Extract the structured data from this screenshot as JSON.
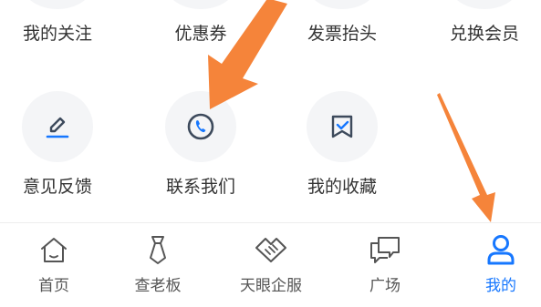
{
  "menu": {
    "row1": [
      "我的关注",
      "优惠券",
      "发票抬头",
      "兑换会员"
    ],
    "row2": [
      {
        "label": "意见反馈",
        "icon": "pen-icon"
      },
      {
        "label": "联系我们",
        "icon": "phone-icon"
      },
      {
        "label": "我的收藏",
        "icon": "bookmark-icon"
      }
    ]
  },
  "tabbar": {
    "tabs": [
      {
        "label": "首页",
        "icon": "home-icon"
      },
      {
        "label": "查老板",
        "icon": "tie-icon"
      },
      {
        "label": "天眼企服",
        "icon": "handshake-icon"
      },
      {
        "label": "广场",
        "icon": "chat-icon"
      },
      {
        "label": "我的",
        "icon": "person-icon"
      }
    ],
    "active_index": 4
  },
  "colors": {
    "accent": "#1677ff",
    "icon_dark": "#3d4a5c",
    "arrow": "#f5843a"
  }
}
